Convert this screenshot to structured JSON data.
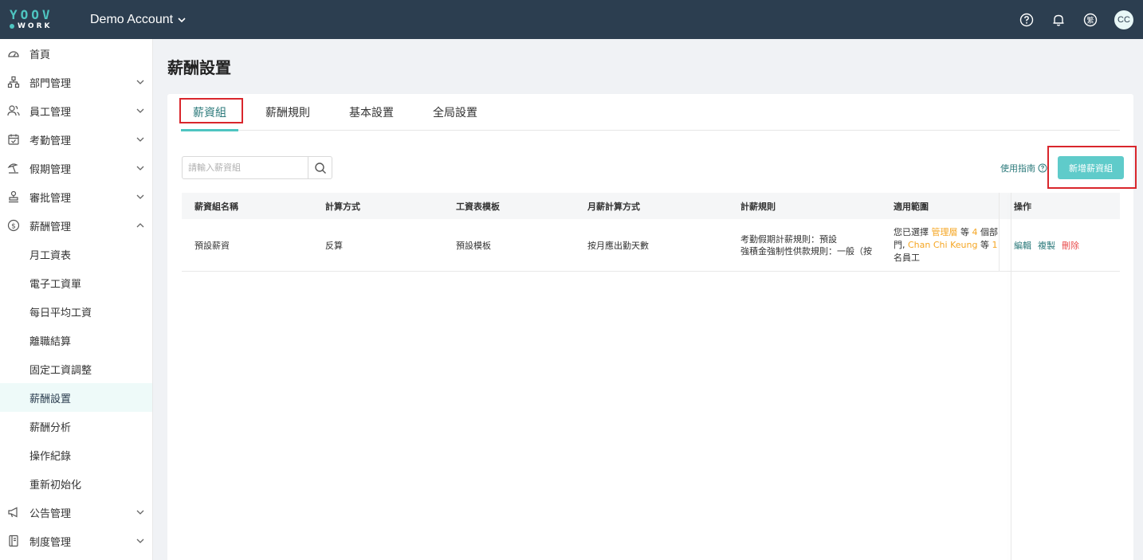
{
  "header": {
    "logo_top": "YOOV",
    "logo_bottom": "WORK",
    "account": "Demo Account",
    "avatar": "CC",
    "icons": [
      "help-icon",
      "bell-icon",
      "language-icon"
    ],
    "lang_glyph": "繁"
  },
  "sidebar": {
    "items": [
      {
        "label": "首頁",
        "icon": "dashboard-icon"
      },
      {
        "label": "部門管理",
        "icon": "org-icon"
      },
      {
        "label": "員工管理",
        "icon": "people-icon"
      },
      {
        "label": "考勤管理",
        "icon": "calendar-icon"
      },
      {
        "label": "假期管理",
        "icon": "beach-icon"
      },
      {
        "label": "審批管理",
        "icon": "stamp-icon"
      },
      {
        "label": "薪酬管理",
        "icon": "dollar-icon"
      }
    ],
    "sub_items": [
      "月工資表",
      "電子工資單",
      "每日平均工資",
      "離職結算",
      "固定工資調整",
      "薪酬設置",
      "薪酬分析",
      "操作紀錄",
      "重新初始化"
    ],
    "bottom_items": [
      {
        "label": "公告管理",
        "icon": "megaphone-icon"
      },
      {
        "label": "制度管理",
        "icon": "book-icon"
      }
    ]
  },
  "page": {
    "title": "薪酬設置",
    "tabs": [
      "薪資組",
      "薪酬規則",
      "基本設置",
      "全局設置"
    ],
    "search_placeholder": "請輸入薪資組",
    "guide": "使用指南",
    "add_button": "新增薪資組"
  },
  "table": {
    "headers": [
      "薪資組名稱",
      "計算方式",
      "工資表模板",
      "月薪計算方式",
      "計薪規則",
      "適用範圍",
      "操作"
    ],
    "rows": [
      {
        "name": "預設薪資",
        "method": "反算",
        "template": "預設模板",
        "monthly": "按月應出勤天數",
        "rule_line1": "考勤假期計薪規則：預設",
        "rule_line2": "強積金強制性供款規則：一般（按",
        "scope_a": "您已選擇",
        "scope_role": "管理層",
        "scope_b": "等",
        "scope_count1": "4",
        "scope_c": "個部門,",
        "scope_person": "Chan Chi Keung",
        "scope_d": "等",
        "scope_count2": "1",
        "scope_e": "名員工",
        "actions": [
          "編輯",
          "複製",
          "刪除"
        ]
      }
    ]
  }
}
